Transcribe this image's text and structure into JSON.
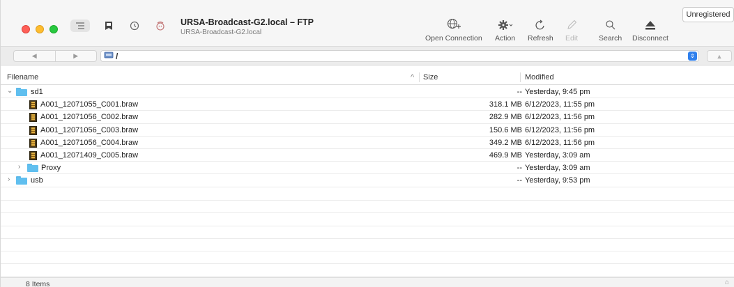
{
  "window": {
    "title": "URSA-Broadcast-G2.local – FTP",
    "subtitle": "URSA-Broadcast-G2.local"
  },
  "toolbar": {
    "left_icons": [
      "outline-view-icon",
      "bookmark-icon",
      "history-icon",
      "bonjour-icon"
    ],
    "actions": [
      {
        "label": "Open Connection",
        "icon": "globe-plus-icon",
        "enabled": true
      },
      {
        "label": "Action",
        "icon": "gear-icon",
        "enabled": true
      },
      {
        "label": "Refresh",
        "icon": "refresh-icon",
        "enabled": true
      },
      {
        "label": "Edit",
        "icon": "pencil-icon",
        "enabled": false
      },
      {
        "label": "Search",
        "icon": "search-icon",
        "enabled": true
      },
      {
        "label": "Disconnect",
        "icon": "eject-icon",
        "enabled": true
      }
    ],
    "unregistered_label": "Unregistered"
  },
  "pathbar": {
    "path": "/"
  },
  "table": {
    "columns": {
      "filename": "Filename",
      "size": "Size",
      "modified": "Modified"
    },
    "rows": [
      {
        "name": "sd1",
        "size": "--",
        "modified": "Yesterday, 9:45 pm",
        "type": "folder",
        "level": 0,
        "expanded": true
      },
      {
        "name": "A001_12071055_C001.braw",
        "size": "318.1 MB",
        "modified": "6/12/2023, 11:55 pm",
        "type": "file",
        "level": 1
      },
      {
        "name": "A001_12071056_C002.braw",
        "size": "282.9 MB",
        "modified": "6/12/2023, 11:56 pm",
        "type": "file",
        "level": 1
      },
      {
        "name": "A001_12071056_C003.braw",
        "size": "150.6 MB",
        "modified": "6/12/2023, 11:56 pm",
        "type": "file",
        "level": 1
      },
      {
        "name": "A001_12071056_C004.braw",
        "size": "349.2 MB",
        "modified": "6/12/2023, 11:56 pm",
        "type": "file",
        "level": 1
      },
      {
        "name": "A001_12071409_C005.braw",
        "size": "469.9 MB",
        "modified": "Yesterday, 3:09 am",
        "type": "file",
        "level": 1
      },
      {
        "name": "Proxy",
        "size": "--",
        "modified": "Yesterday, 3:09 am",
        "type": "folder",
        "level": 1,
        "expanded": false
      },
      {
        "name": "usb",
        "size": "--",
        "modified": "Yesterday, 9:53 pm",
        "type": "folder",
        "level": 0,
        "expanded": false
      }
    ]
  },
  "status": {
    "items_label": "8 Items"
  }
}
